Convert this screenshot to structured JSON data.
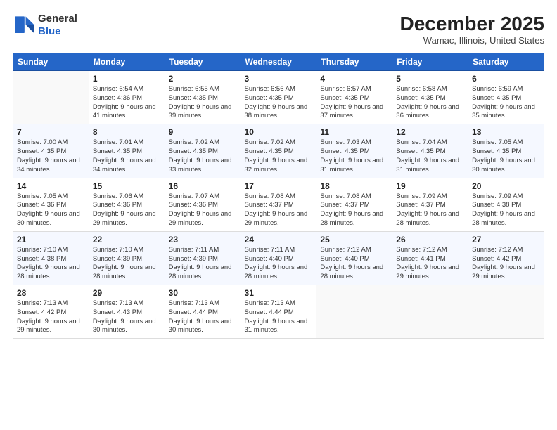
{
  "header": {
    "logo": {
      "general": "General",
      "blue": "Blue"
    },
    "title": "December 2025",
    "location": "Wamac, Illinois, United States"
  },
  "weekdays": [
    "Sunday",
    "Monday",
    "Tuesday",
    "Wednesday",
    "Thursday",
    "Friday",
    "Saturday"
  ],
  "weeks": [
    [
      {
        "num": "",
        "empty": true
      },
      {
        "num": "1",
        "sunrise": "6:54 AM",
        "sunset": "4:36 PM",
        "daylight": "9 hours and 41 minutes."
      },
      {
        "num": "2",
        "sunrise": "6:55 AM",
        "sunset": "4:35 PM",
        "daylight": "9 hours and 39 minutes."
      },
      {
        "num": "3",
        "sunrise": "6:56 AM",
        "sunset": "4:35 PM",
        "daylight": "9 hours and 38 minutes."
      },
      {
        "num": "4",
        "sunrise": "6:57 AM",
        "sunset": "4:35 PM",
        "daylight": "9 hours and 37 minutes."
      },
      {
        "num": "5",
        "sunrise": "6:58 AM",
        "sunset": "4:35 PM",
        "daylight": "9 hours and 36 minutes."
      },
      {
        "num": "6",
        "sunrise": "6:59 AM",
        "sunset": "4:35 PM",
        "daylight": "9 hours and 35 minutes."
      }
    ],
    [
      {
        "num": "7",
        "sunrise": "7:00 AM",
        "sunset": "4:35 PM",
        "daylight": "9 hours and 34 minutes."
      },
      {
        "num": "8",
        "sunrise": "7:01 AM",
        "sunset": "4:35 PM",
        "daylight": "9 hours and 34 minutes."
      },
      {
        "num": "9",
        "sunrise": "7:02 AM",
        "sunset": "4:35 PM",
        "daylight": "9 hours and 33 minutes."
      },
      {
        "num": "10",
        "sunrise": "7:02 AM",
        "sunset": "4:35 PM",
        "daylight": "9 hours and 32 minutes."
      },
      {
        "num": "11",
        "sunrise": "7:03 AM",
        "sunset": "4:35 PM",
        "daylight": "9 hours and 31 minutes."
      },
      {
        "num": "12",
        "sunrise": "7:04 AM",
        "sunset": "4:35 PM",
        "daylight": "9 hours and 31 minutes."
      },
      {
        "num": "13",
        "sunrise": "7:05 AM",
        "sunset": "4:35 PM",
        "daylight": "9 hours and 30 minutes."
      }
    ],
    [
      {
        "num": "14",
        "sunrise": "7:05 AM",
        "sunset": "4:36 PM",
        "daylight": "9 hours and 30 minutes."
      },
      {
        "num": "15",
        "sunrise": "7:06 AM",
        "sunset": "4:36 PM",
        "daylight": "9 hours and 29 minutes."
      },
      {
        "num": "16",
        "sunrise": "7:07 AM",
        "sunset": "4:36 PM",
        "daylight": "9 hours and 29 minutes."
      },
      {
        "num": "17",
        "sunrise": "7:08 AM",
        "sunset": "4:37 PM",
        "daylight": "9 hours and 29 minutes."
      },
      {
        "num": "18",
        "sunrise": "7:08 AM",
        "sunset": "4:37 PM",
        "daylight": "9 hours and 28 minutes."
      },
      {
        "num": "19",
        "sunrise": "7:09 AM",
        "sunset": "4:37 PM",
        "daylight": "9 hours and 28 minutes."
      },
      {
        "num": "20",
        "sunrise": "7:09 AM",
        "sunset": "4:38 PM",
        "daylight": "9 hours and 28 minutes."
      }
    ],
    [
      {
        "num": "21",
        "sunrise": "7:10 AM",
        "sunset": "4:38 PM",
        "daylight": "9 hours and 28 minutes."
      },
      {
        "num": "22",
        "sunrise": "7:10 AM",
        "sunset": "4:39 PM",
        "daylight": "9 hours and 28 minutes."
      },
      {
        "num": "23",
        "sunrise": "7:11 AM",
        "sunset": "4:39 PM",
        "daylight": "9 hours and 28 minutes."
      },
      {
        "num": "24",
        "sunrise": "7:11 AM",
        "sunset": "4:40 PM",
        "daylight": "9 hours and 28 minutes."
      },
      {
        "num": "25",
        "sunrise": "7:12 AM",
        "sunset": "4:40 PM",
        "daylight": "9 hours and 28 minutes."
      },
      {
        "num": "26",
        "sunrise": "7:12 AM",
        "sunset": "4:41 PM",
        "daylight": "9 hours and 29 minutes."
      },
      {
        "num": "27",
        "sunrise": "7:12 AM",
        "sunset": "4:42 PM",
        "daylight": "9 hours and 29 minutes."
      }
    ],
    [
      {
        "num": "28",
        "sunrise": "7:13 AM",
        "sunset": "4:42 PM",
        "daylight": "9 hours and 29 minutes."
      },
      {
        "num": "29",
        "sunrise": "7:13 AM",
        "sunset": "4:43 PM",
        "daylight": "9 hours and 30 minutes."
      },
      {
        "num": "30",
        "sunrise": "7:13 AM",
        "sunset": "4:44 PM",
        "daylight": "9 hours and 30 minutes."
      },
      {
        "num": "31",
        "sunrise": "7:13 AM",
        "sunset": "4:44 PM",
        "daylight": "9 hours and 31 minutes."
      },
      {
        "num": "",
        "empty": true
      },
      {
        "num": "",
        "empty": true
      },
      {
        "num": "",
        "empty": true
      }
    ]
  ],
  "labels": {
    "sunrise": "Sunrise:",
    "sunset": "Sunset:",
    "daylight": "Daylight:"
  }
}
